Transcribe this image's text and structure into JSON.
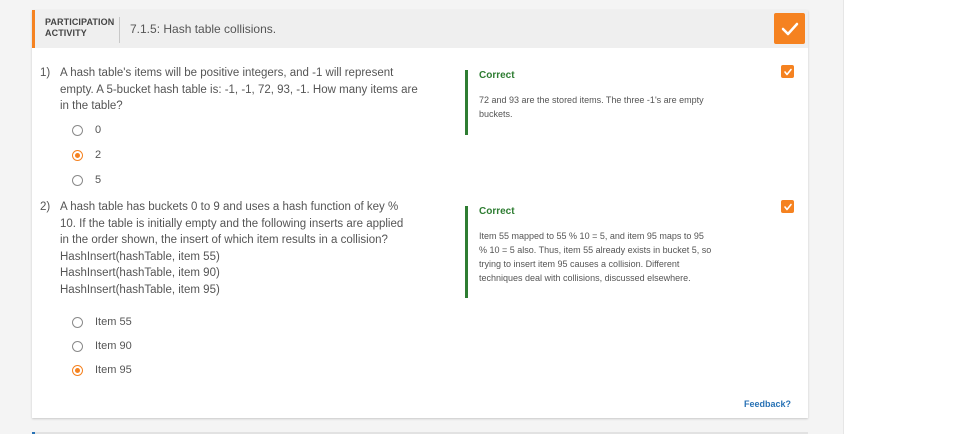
{
  "activity": {
    "label_line1": "PARTICIPATION",
    "label_line2": "ACTIVITY",
    "title": "7.1.5: Hash table collisions."
  },
  "questions": [
    {
      "number_text": "1)",
      "text_lines": [
        "A hash table's items will be positive integers, and -1 will represent",
        "empty. A 5-bucket hash table is: -1, -1, 72, 93, -1. How many items are",
        "in the table?"
      ],
      "options": [
        {
          "label": "0",
          "selected": false
        },
        {
          "label": "2",
          "selected": true
        },
        {
          "label": "5",
          "selected": false
        }
      ],
      "result": "Correct",
      "explanation_lines": [
        "72 and 93 are the stored items. The three -1's are empty",
        "buckets."
      ]
    },
    {
      "number_text": "2)",
      "text_lines": [
        "A hash table has buckets 0 to 9 and uses a hash function of key %",
        "10. If the table is initially empty and the following inserts are applied",
        "in the order shown, the insert of which item results in a collision?",
        "HashInsert(hashTable, item 55)",
        "HashInsert(hashTable, item 90)",
        "HashInsert(hashTable, item 95)"
      ],
      "options": [
        {
          "label": "Item 55",
          "selected": false
        },
        {
          "label": "Item 90",
          "selected": false
        },
        {
          "label": "Item 95",
          "selected": true
        }
      ],
      "result": "Correct",
      "explanation_lines": [
        "Item 55 mapped to 55 % 10 = 5, and item 95 maps to 95",
        "% 10 = 5 also. Thus, item 55 already exists in bucket 5, so",
        "trying to insert item 95 causes a collision. Different",
        "techniques deal with collisions, discussed elsewhere."
      ]
    }
  ],
  "feedback_link": "Feedback?",
  "colors": {
    "accent": "#f58220",
    "correct": "#2e7d32",
    "link": "#2872b5"
  }
}
